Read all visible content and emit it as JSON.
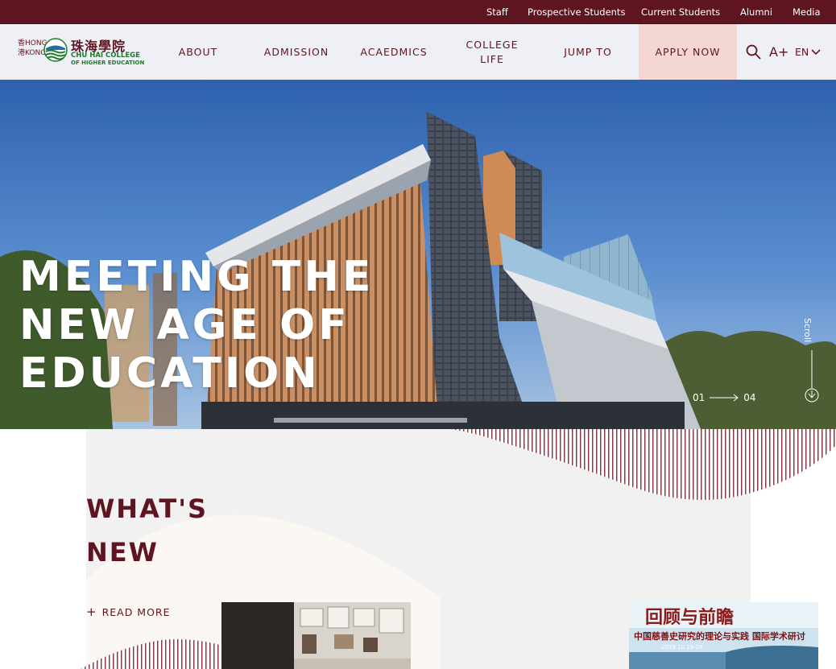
{
  "utility_nav": {
    "links": [
      "Staff",
      "Prospective Students",
      "Current Students",
      "Alumni",
      "Media"
    ]
  },
  "logo": {
    "region_label_1": "香HONG",
    "region_label_2": "港KONG",
    "chinese_name": "珠海學院",
    "english_name_1": "CHU HAI COLLEGE",
    "english_name_2": "OF HIGHER EDUCATION"
  },
  "main_nav": {
    "items": [
      "ABOUT",
      "ADMISSION",
      "ACAEDMICS",
      "COLLEGE LIFE",
      "JUMP TO"
    ],
    "apply_label": "APPLY NOW",
    "font_size_label": "A+",
    "lang_label": "EN"
  },
  "hero": {
    "title_lines": [
      "MEETING THE",
      "NEW AGE OF",
      "EDUCATION"
    ],
    "slide_current": "01",
    "slide_total": "04",
    "scroll_label": "Scroll"
  },
  "news": {
    "title_lines": [
      "WHAT'S",
      "NEW"
    ],
    "read_more_label": "READ MORE",
    "card2_banner_text": "回顾与前瞻",
    "card2_subtitle_text": "中国慈善史研究的理论与实践 国际学术研讨",
    "card2_date_text": "2019.10.19-20"
  },
  "colors": {
    "brand_maroon": "#5e1520",
    "header_bg": "#eef0f5",
    "apply_bg": "#f4d6d3",
    "news_panel_bg": "#f1f1f1"
  }
}
